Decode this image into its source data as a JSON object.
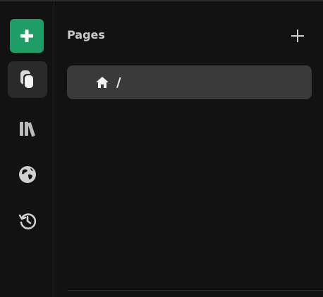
{
  "rail": {
    "items": [
      {
        "name": "add",
        "icon": "plus-icon"
      },
      {
        "name": "pages",
        "icon": "pages-icon",
        "active": true
      },
      {
        "name": "library",
        "icon": "library-icon"
      },
      {
        "name": "globe",
        "icon": "globe-icon"
      },
      {
        "name": "history",
        "icon": "history-icon"
      }
    ],
    "accent": "#1f9d67"
  },
  "panel": {
    "title": "Pages",
    "add_icon": "plus-icon",
    "pages": [
      {
        "icon": "home-icon",
        "label": "/"
      }
    ]
  }
}
